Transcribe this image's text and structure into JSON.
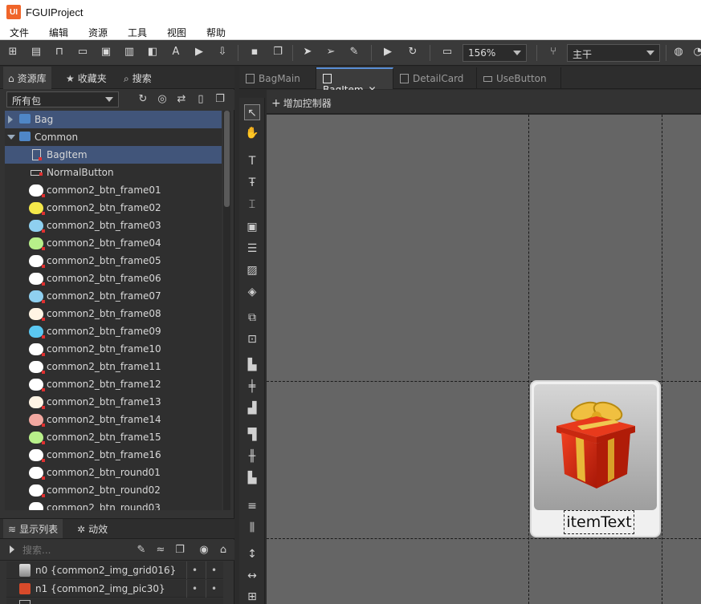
{
  "window": {
    "title": "FGUIProject",
    "logo": "UI"
  },
  "menubar": [
    "文件",
    "编辑",
    "资源",
    "工具",
    "视图",
    "帮助"
  ],
  "toolbar": {
    "zoom": "156%",
    "branch": "主干"
  },
  "library": {
    "tabs": [
      {
        "label": "资源库",
        "icon": "home-icon"
      },
      {
        "label": "收藏夹",
        "icon": "star-icon"
      },
      {
        "label": "搜索",
        "icon": "search-icon"
      }
    ],
    "package_select": "所有包",
    "tree": [
      {
        "label": "Bag",
        "type": "folder",
        "expanded": false,
        "selected": true
      },
      {
        "label": "Common",
        "type": "folder",
        "expanded": true,
        "selected": false
      },
      {
        "label": "BagItem",
        "type": "component",
        "selected": true
      },
      {
        "label": "NormalButton",
        "type": "button"
      },
      {
        "label": "common2_btn_frame01",
        "color": "#ffffff"
      },
      {
        "label": "common2_btn_frame02",
        "color": "#f4e84a"
      },
      {
        "label": "common2_btn_frame03",
        "color": "#8fd0f0"
      },
      {
        "label": "common2_btn_frame04",
        "color": "#b8f08a"
      },
      {
        "label": "common2_btn_frame05",
        "color": "#ffffff"
      },
      {
        "label": "common2_btn_frame06",
        "color": "#ffffff"
      },
      {
        "label": "common2_btn_frame07",
        "color": "#8fd0f0"
      },
      {
        "label": "common2_btn_frame08",
        "color": "#fff4e4"
      },
      {
        "label": "common2_btn_frame09",
        "color": "#5bc8f2"
      },
      {
        "label": "common2_btn_frame10",
        "color": "#ffffff"
      },
      {
        "label": "common2_btn_frame11",
        "color": "#ffffff"
      },
      {
        "label": "common2_btn_frame12",
        "color": "#ffffff"
      },
      {
        "label": "common2_btn_frame13",
        "color": "#fff4e4"
      },
      {
        "label": "common2_btn_frame14",
        "color": "#f2a8a0"
      },
      {
        "label": "common2_btn_frame15",
        "color": "#b8f08a"
      },
      {
        "label": "common2_btn_frame16",
        "color": "#ffffff"
      },
      {
        "label": "common2_btn_round01",
        "color": "#ffffff"
      },
      {
        "label": "common2_btn_round02",
        "color": "#ffffff"
      },
      {
        "label": "common2_btn_round03",
        "color": "#ffffff"
      }
    ]
  },
  "display_list": {
    "tabs": [
      {
        "label": "显示列表",
        "icon": "layers-icon"
      },
      {
        "label": "动效",
        "icon": "effects-icon"
      }
    ],
    "search_placeholder": "搜索...",
    "items": [
      {
        "label": "n0 {common2_img_grid016}"
      },
      {
        "label": "n1 {common2_img_pic30}"
      }
    ]
  },
  "documents": {
    "tabs": [
      {
        "label": "BagMain",
        "active": false
      },
      {
        "label": "BagItem",
        "active": true
      },
      {
        "label": "DetailCard",
        "active": false
      },
      {
        "label": "UseButton",
        "active": false
      }
    ]
  },
  "controller_bar": {
    "add_label": "增加控制器"
  },
  "canvas": {
    "item_text": "itemText",
    "background": "#656565"
  }
}
